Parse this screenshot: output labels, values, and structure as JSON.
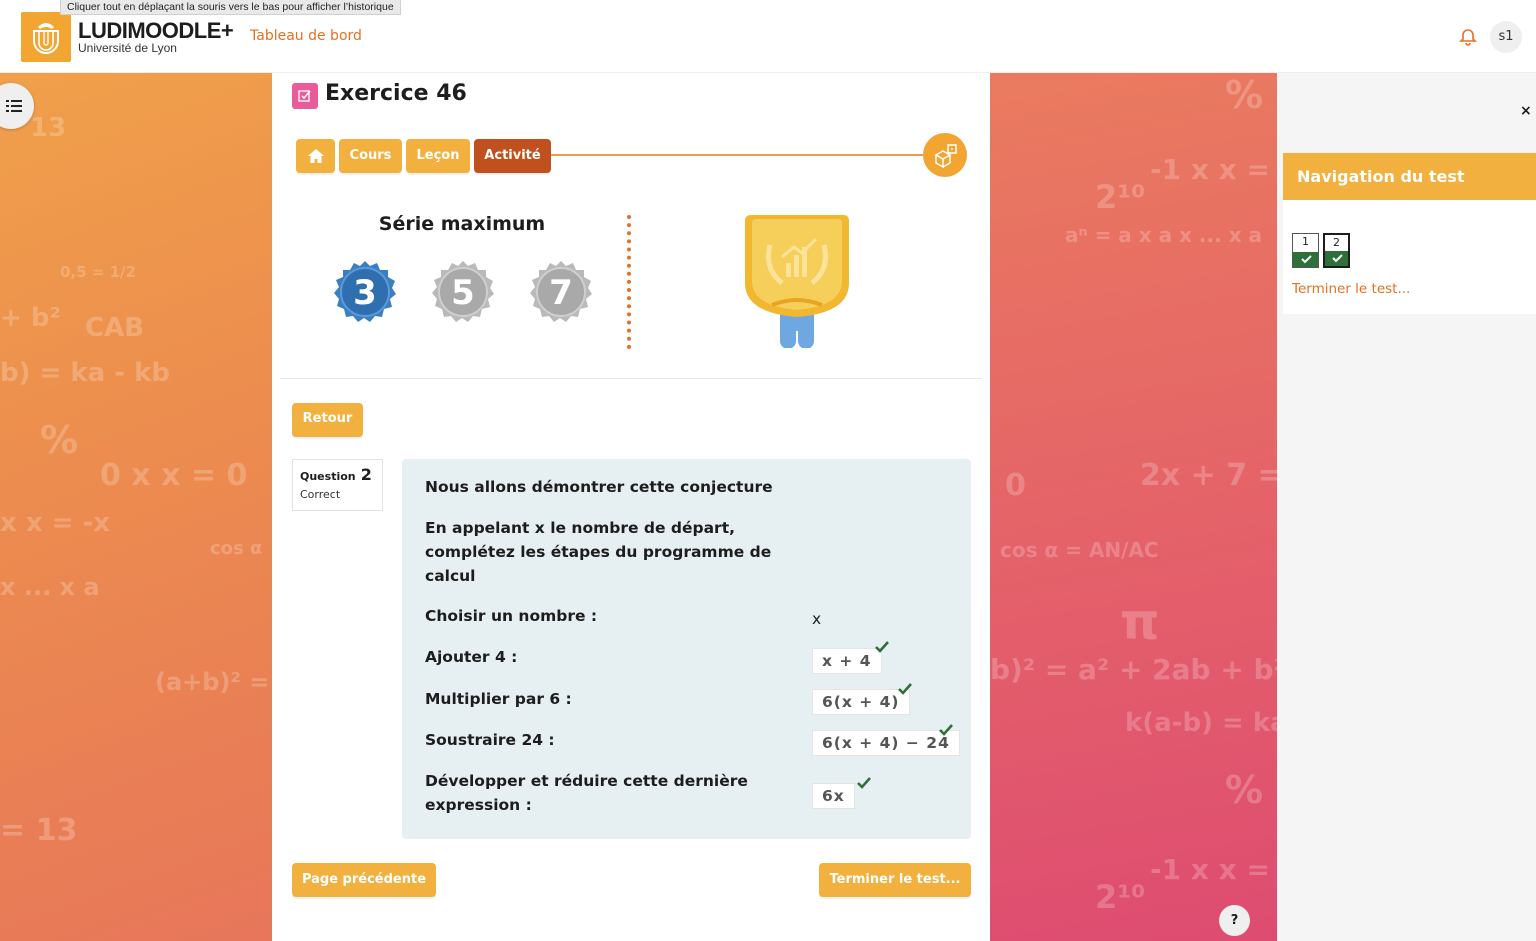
{
  "tooltip": "Cliquer tout en déplaçant la souris vers le bas pour afficher l’historique",
  "brand": {
    "title": "LUDIMOODLE+",
    "subtitle": "Université de Lyon"
  },
  "header": {
    "dashboard_link": "Tableau de bord",
    "avatar_initials": "s1",
    "bell_icon": "bell-icon"
  },
  "page": {
    "title": "Exercice 46"
  },
  "breadcrumb": {
    "home_icon": "home-icon",
    "items": [
      "Cours",
      "Leçon",
      "Activité"
    ],
    "active": "Activité",
    "end_icon": "dice-icon"
  },
  "serie": {
    "title": "Série maximum",
    "badges": [
      "3",
      "5",
      "7"
    ],
    "active_badge": "3"
  },
  "buttons": {
    "retour": "Retour",
    "prev": "Page précédente",
    "finish": "Terminer le test..."
  },
  "question": {
    "label": "Question",
    "number": "2",
    "state": "Correct",
    "intro": "Nous allons démontrer cette conjecture",
    "instruction": "En appelant x le nombre de départ, complétez les étapes du programme de calcul",
    "steps": [
      {
        "label": "Choisir un nombre :",
        "answer": "x"
      },
      {
        "label": "Ajouter 4 :",
        "answer": "x + 4"
      },
      {
        "label": "Multiplier par 6 :",
        "answer": "6(x + 4)"
      },
      {
        "label": "Soustraire 24 :",
        "answer": "6(x + 4) − 24"
      },
      {
        "label": "Développer et réduire cette dernière expression :",
        "answer": "6x"
      }
    ]
  },
  "drawer": {
    "close": "×",
    "nav_title": "Navigation du test",
    "questions": [
      {
        "num": "1",
        "state": "correct"
      },
      {
        "num": "2",
        "state": "correct",
        "current": true
      }
    ],
    "finish_link": "Terminer le test..."
  },
  "help": "?",
  "colors": {
    "accent": "#f2b13f",
    "active_crumb": "#c0511f",
    "link": "#e3711f",
    "correct": "#2e6f3a",
    "badge_active": "#3a7fc2",
    "badge_inactive": "#a9a9a9"
  }
}
